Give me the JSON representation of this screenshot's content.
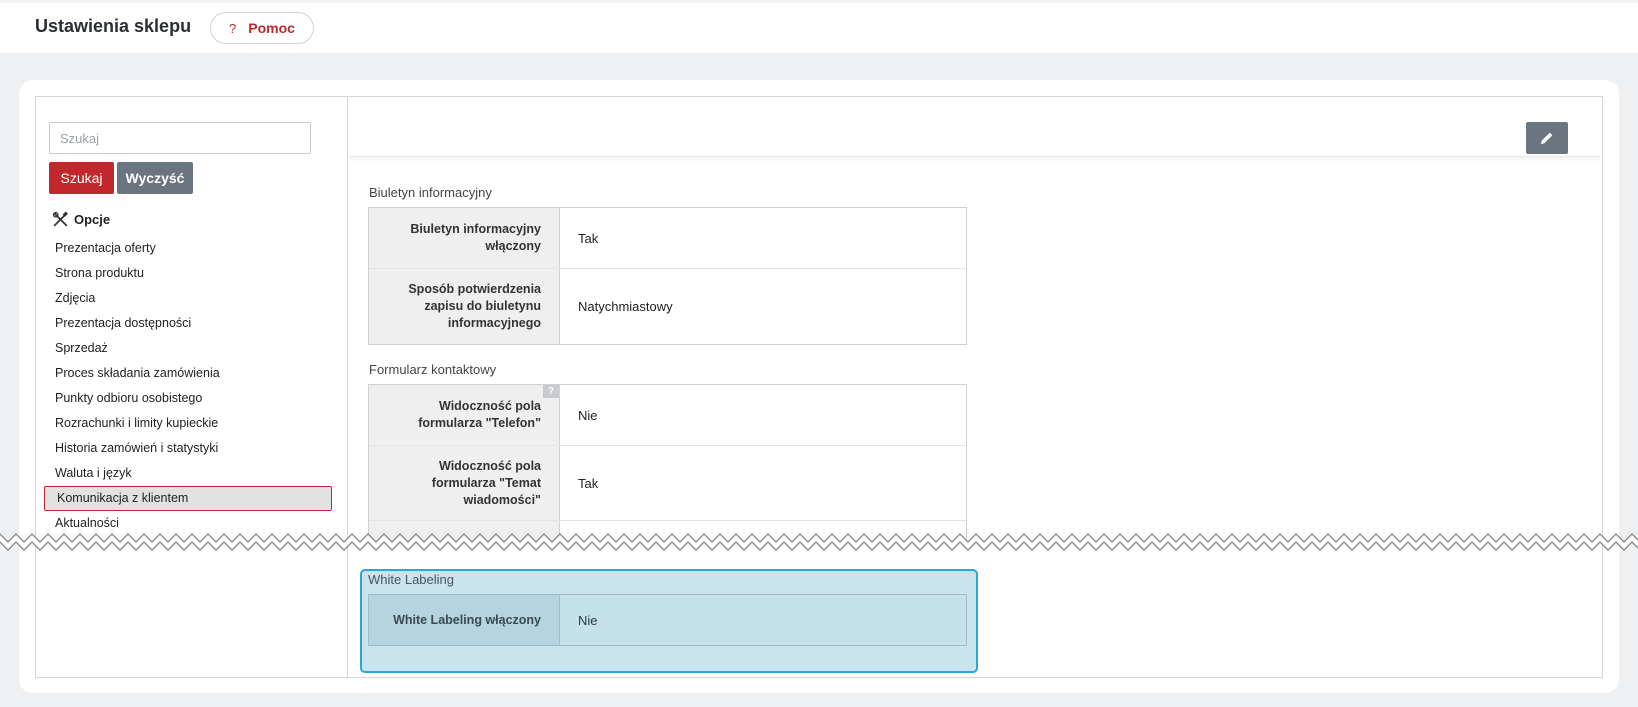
{
  "header": {
    "title": "Ustawienia sklepu",
    "help_icon": "?",
    "help_label": "Pomoc"
  },
  "sidebar": {
    "search_placeholder": "Szukaj",
    "search_button": "Szukaj",
    "clear_button": "Wyczyść",
    "options_title": "Opcje",
    "items": [
      {
        "label": "Prezentacja oferty"
      },
      {
        "label": "Strona produktu"
      },
      {
        "label": "Zdjęcia"
      },
      {
        "label": "Prezentacja dostępności"
      },
      {
        "label": "Sprzedaż"
      },
      {
        "label": "Proces składania zamówienia"
      },
      {
        "label": "Punkty odbioru osobistego"
      },
      {
        "label": "Rozrachunki i limity kupieckie"
      },
      {
        "label": "Historia zamówień i statystyki"
      },
      {
        "label": "Waluta i język"
      },
      {
        "label": "Komunikacja z klientem"
      },
      {
        "label": "Aktualności"
      }
    ],
    "active_item": "Komunikacja z klientem"
  },
  "main": {
    "edit_icon": "pencil-icon",
    "sections": [
      {
        "title": "Biuletyn informacyjny",
        "rows": [
          {
            "label": "Biuletyn informacyjny włączony",
            "value": "Tak"
          },
          {
            "label": "Sposób potwierdzenia zapisu do biuletynu informacyjnego",
            "value": "Natychmiastowy"
          }
        ]
      },
      {
        "title": "Formularz kontaktowy",
        "help_marker": "?",
        "rows": [
          {
            "label": "Widoczność pola formularza \"Telefon\"",
            "value": "Nie"
          },
          {
            "label": "Widoczność pola formularza \"Temat wiadomości\"",
            "value": "Tak"
          }
        ]
      },
      {
        "title": "White Labeling",
        "rows": [
          {
            "label": "White Labeling włączony",
            "value": "Nie"
          }
        ]
      }
    ]
  },
  "colors": {
    "accent": "#c1272d",
    "secondary": "#6b7580",
    "highlight_border": "#29a7d8",
    "highlight_fill": "#c9e4ec"
  }
}
